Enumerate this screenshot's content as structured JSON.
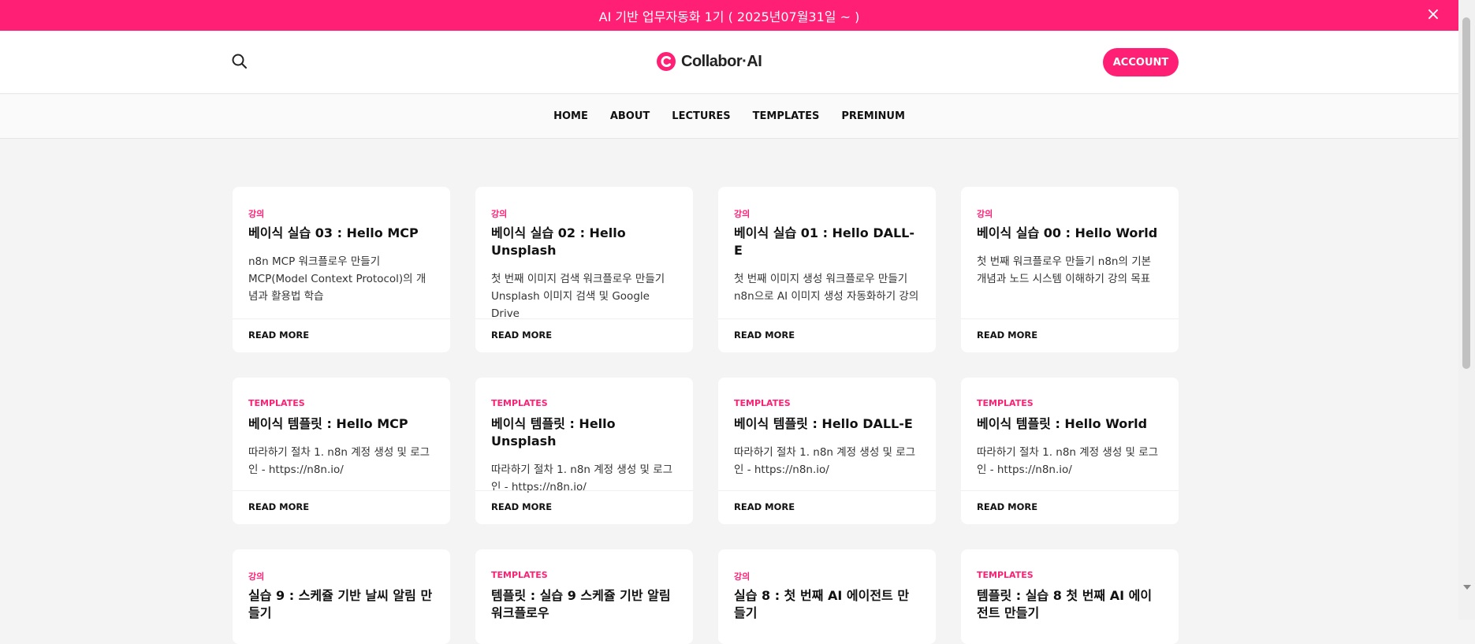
{
  "banner": {
    "text": "AI 기반 업무자동화 1기 ( 2025년07월31일 ~ )",
    "close_icon": "close-icon"
  },
  "header": {
    "search_icon": "search-icon",
    "logo_text": "Collabor·AI",
    "account_label": "ACCOUNT"
  },
  "nav": {
    "items": [
      {
        "label": "HOME"
      },
      {
        "label": "ABOUT"
      },
      {
        "label": "LECTURES"
      },
      {
        "label": "TEMPLATES"
      },
      {
        "label": "PREMINUM"
      }
    ]
  },
  "colors": {
    "brand": "#ff1f75",
    "page_bg": "#f4f4f4",
    "card_bg": "#ffffff"
  },
  "cards": [
    {
      "category": "강의",
      "title": "베이식 실습 03 : Hello MCP",
      "excerpt": "n8n MCP 워크플로우 만들기 MCP(Model Context Protocol)의 개념과 활용법 학습",
      "cta": "READ MORE"
    },
    {
      "category": "강의",
      "title": "베이식 실습 02 : Hello Unsplash",
      "excerpt": "첫 번째 이미지 검색 워크플로우 만들기 Unsplash 이미지 검색 및 Google Drive",
      "cta": "READ MORE"
    },
    {
      "category": "강의",
      "title": "베이식 실습 01 : Hello DALL-E",
      "excerpt": "첫 번째 이미지 생성 워크플로우 만들기 n8n으로 AI 이미지 생성 자동화하기 강의",
      "cta": "READ MORE"
    },
    {
      "category": "강의",
      "title": "베이식 실습 00 : Hello World",
      "excerpt": "첫 번째 워크플로우 만들기 n8n의 기본 개념과 노드 시스템 이해하기 강의 목표",
      "cta": "READ MORE"
    },
    {
      "category": "TEMPLATES",
      "title": "베이식 템플릿 : Hello MCP",
      "excerpt": "따라하기 절차 1. n8n 계정 생성 및 로그인 - https://n8n.io/",
      "cta": "READ MORE"
    },
    {
      "category": "TEMPLATES",
      "title": "베이식 템플릿 : Hello Unsplash",
      "excerpt": "따라하기 절차 1. n8n 계정 생성 및 로그인 - https://n8n.io/",
      "cta": "READ MORE"
    },
    {
      "category": "TEMPLATES",
      "title": "베이식 템플릿 : Hello DALL-E",
      "excerpt": "따라하기 절차 1. n8n 계정 생성 및 로그인 - https://n8n.io/",
      "cta": "READ MORE"
    },
    {
      "category": "TEMPLATES",
      "title": "베이식 템플릿 : Hello World",
      "excerpt": "따라하기 절차 1. n8n 계정 생성 및 로그인 - https://n8n.io/",
      "cta": "READ MORE"
    },
    {
      "category": "강의",
      "title": "실습 9 : 스케쥴 기반 날씨 알림 만들기",
      "excerpt": "",
      "cta": ""
    },
    {
      "category": "TEMPLATES",
      "title": "템플릿 : 실습 9 스케쥴 기반 알림 워크플로우",
      "excerpt": "",
      "cta": ""
    },
    {
      "category": "강의",
      "title": "실습 8 : 첫 번째 AI 에이전트 만들기",
      "excerpt": "",
      "cta": ""
    },
    {
      "category": "TEMPLATES",
      "title": "템플릿 : 실습 8 첫 번째 AI 에이전트 만들기",
      "excerpt": "",
      "cta": ""
    }
  ]
}
